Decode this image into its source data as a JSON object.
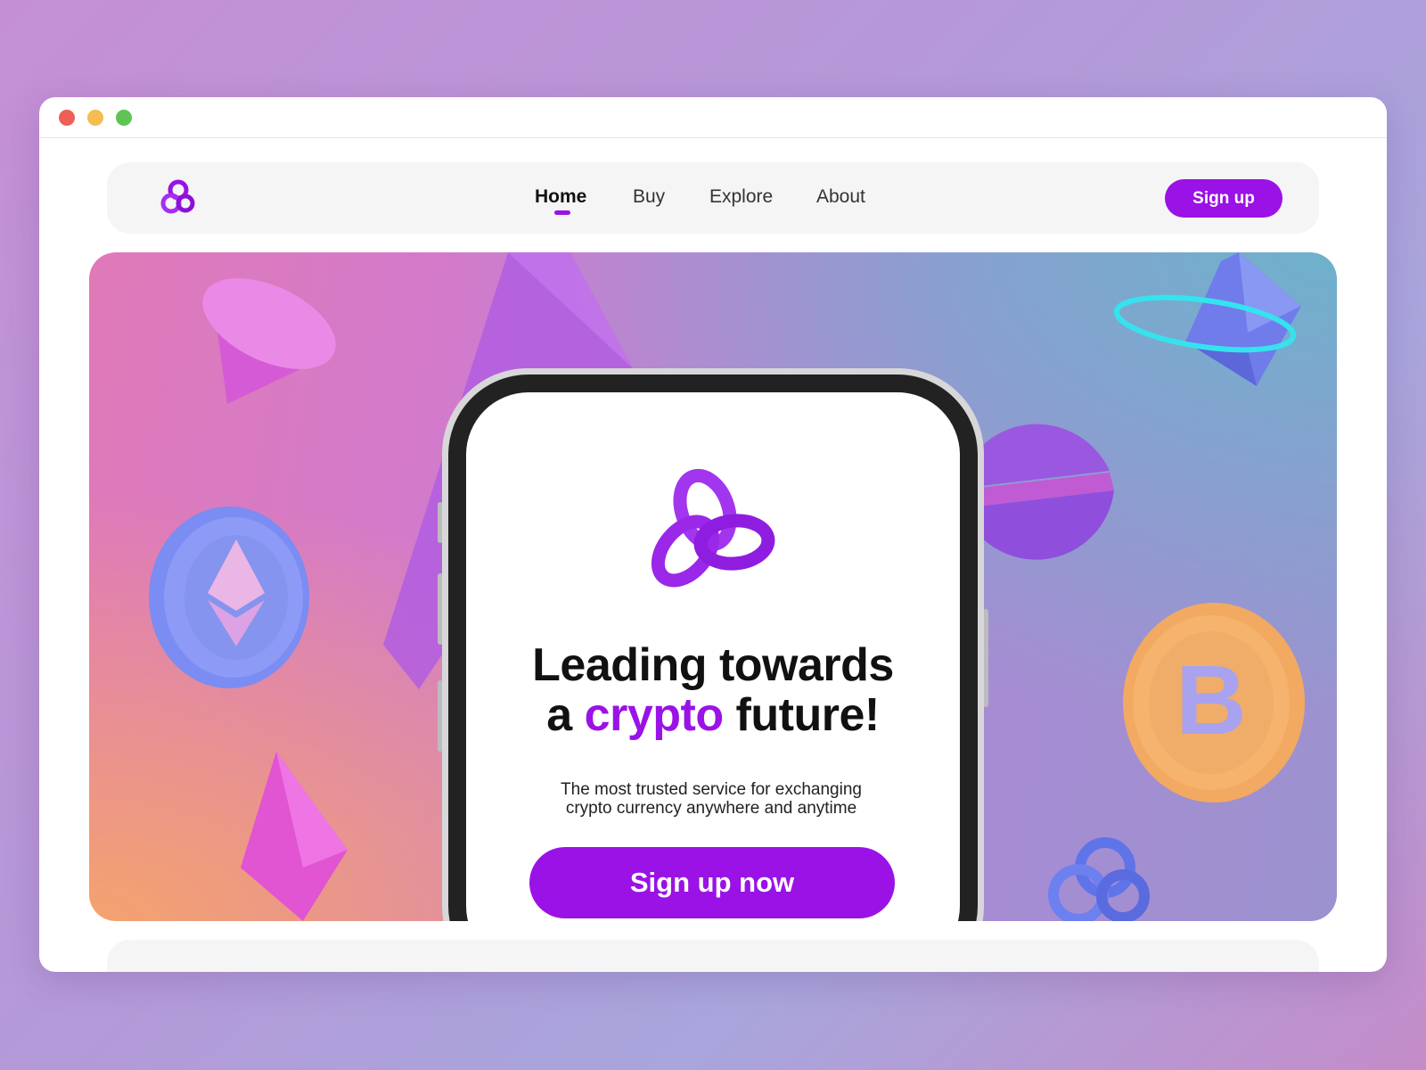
{
  "window": {
    "controls": [
      "close",
      "minimize",
      "maximize"
    ]
  },
  "navbar": {
    "logo_icon": "knot-logo-icon",
    "links": [
      {
        "label": "Home",
        "active": true
      },
      {
        "label": "Buy",
        "active": false
      },
      {
        "label": "Explore",
        "active": false
      },
      {
        "label": "About",
        "active": false
      }
    ],
    "signup_label": "Sign up"
  },
  "hero": {
    "headline_line1": "Leading towards",
    "headline_a": "a",
    "headline_accent": "crypto",
    "headline_end": "future!",
    "subtext_line1": "The most trusted service for exchanging",
    "subtext_line2": "crypto currency anywhere and anytime",
    "cta_label": "Sign up now",
    "decorations": [
      "cone-shape",
      "pyramid-shape",
      "ethereum-coin-icon",
      "ethereum-gem-icon",
      "ring-orbit",
      "split-sphere",
      "bitcoin-coin-icon",
      "pink-gem-icon",
      "knot-logo-icon"
    ]
  },
  "colors": {
    "accent": "#9a12e5",
    "nav_bg": "#f5f5f5",
    "text_dark": "#111111"
  }
}
